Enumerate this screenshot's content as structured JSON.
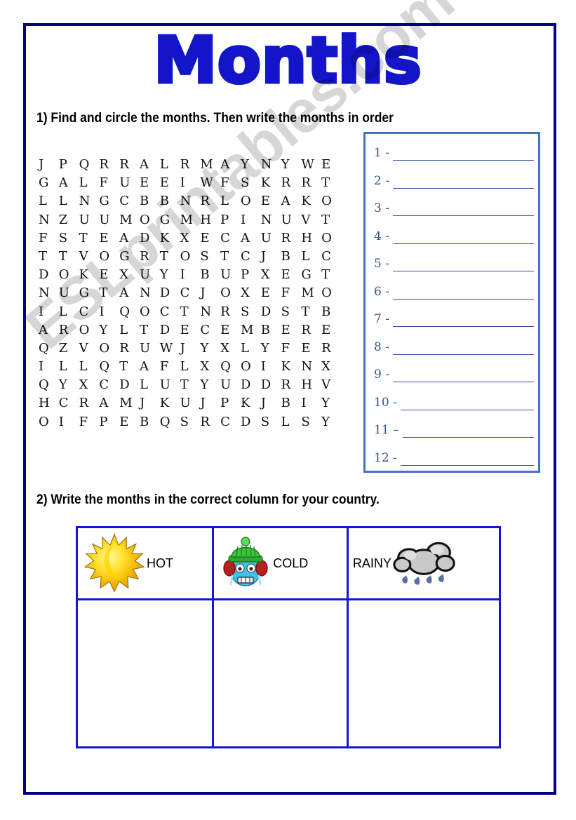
{
  "page": {
    "title": "Months",
    "border_color": "#00008B",
    "background": "#ffffff"
  },
  "watermark": {
    "text": "ESLprintables.com",
    "color": "rgba(0,0,0,0.16)"
  },
  "exercise1": {
    "instruction": "1) Find and circle the months. Then write the months in order",
    "grid": {
      "rows": 16,
      "cols": 15,
      "letters": [
        [
          "J",
          "P",
          "Q",
          "R",
          "R",
          "A",
          "L",
          "R",
          "M",
          "A",
          "Y",
          "N",
          "Y",
          "W",
          "E"
        ],
        [
          "G",
          "A",
          "L",
          "F",
          "U",
          "E",
          "E",
          "I",
          "W",
          "F",
          "S",
          "K",
          "R",
          "R",
          "T"
        ],
        [
          "L",
          "L",
          "N",
          "G",
          "C",
          "B",
          "B",
          "N",
          "R",
          "L",
          "O",
          "E",
          "A",
          "K",
          "O"
        ],
        [
          "N",
          "Z",
          "U",
          "U",
          "M",
          "O",
          "G",
          "M",
          "H",
          "P",
          "I",
          "N",
          "U",
          "V",
          "T"
        ],
        [
          "F",
          "S",
          "T",
          "E",
          "A",
          "D",
          "K",
          "X",
          "E",
          "C",
          "A",
          "U",
          "R",
          "H",
          "O"
        ],
        [
          "T",
          "T",
          "V",
          "O",
          "G",
          "R",
          "T",
          "O",
          "S",
          "T",
          "C",
          "J",
          "B",
          "L",
          "C"
        ],
        [
          "D",
          "O",
          "K",
          "E",
          "X",
          "U",
          "Y",
          "I",
          "B",
          "U",
          "P",
          "X",
          "E",
          "G",
          "T"
        ],
        [
          "N",
          "U",
          "G",
          "T",
          "A",
          "N",
          "D",
          "C",
          "J",
          "O",
          "X",
          "E",
          "F",
          "M",
          "O"
        ],
        [
          "I",
          "L",
          "C",
          "I",
          "Q",
          "O",
          "C",
          "T",
          "N",
          "R",
          "S",
          "D",
          "S",
          "T",
          "B"
        ],
        [
          "A",
          "R",
          "O",
          "Y",
          "L",
          "T",
          "D",
          "E",
          "C",
          "E",
          "M",
          "B",
          "E",
          "R",
          "E"
        ],
        [
          "Q",
          "Z",
          "V",
          "O",
          "R",
          "U",
          "W",
          "J",
          "Y",
          "X",
          "L",
          "Y",
          "F",
          "E",
          "R"
        ],
        [
          "I",
          "L",
          "L",
          "Q",
          "T",
          "A",
          "F",
          "L",
          "X",
          "Q",
          "O",
          "I",
          "K",
          "N",
          "X"
        ],
        [
          "Q",
          "Y",
          "X",
          "C",
          "D",
          "L",
          "U",
          "T",
          "Y",
          "U",
          "D",
          "D",
          "R",
          "H",
          "V"
        ],
        [
          "H",
          "C",
          "R",
          "A",
          "M",
          "J",
          "K",
          "U",
          "J",
          "P",
          "K",
          "J",
          "B",
          "I",
          "Y"
        ],
        [
          "O",
          "I",
          "F",
          "P",
          "E",
          "B",
          "Q",
          "S",
          "R",
          "C",
          "D",
          "S",
          "L",
          "S",
          "Y"
        ]
      ]
    },
    "answers": {
      "border_color": "#4472C4",
      "number_color": "#33558B",
      "rule_color": "#2E5395",
      "items": [
        {
          "label": "1 -"
        },
        {
          "label": "2 -"
        },
        {
          "label": "3 -"
        },
        {
          "label": "4 -"
        },
        {
          "label": "5 -"
        },
        {
          "label": "6 -"
        },
        {
          "label": "7 -"
        },
        {
          "label": "8 -"
        },
        {
          "label": "9 -"
        },
        {
          "label": "10 -"
        },
        {
          "label": "11 –"
        },
        {
          "label": "12 -"
        }
      ]
    }
  },
  "exercise2": {
    "instruction": "2) Write the months in the correct column for your country.",
    "table": {
      "border_color": "#1414DC",
      "columns": [
        {
          "label": "HOT",
          "icon": "sun-icon",
          "icon_position": "left"
        },
        {
          "label": "COLD",
          "icon": "cold-face-icon",
          "icon_position": "left"
        },
        {
          "label": "RAINY",
          "icon": "rain-cloud-icon",
          "icon_position": "right"
        }
      ],
      "answer_row": [
        "",
        "",
        ""
      ]
    }
  }
}
